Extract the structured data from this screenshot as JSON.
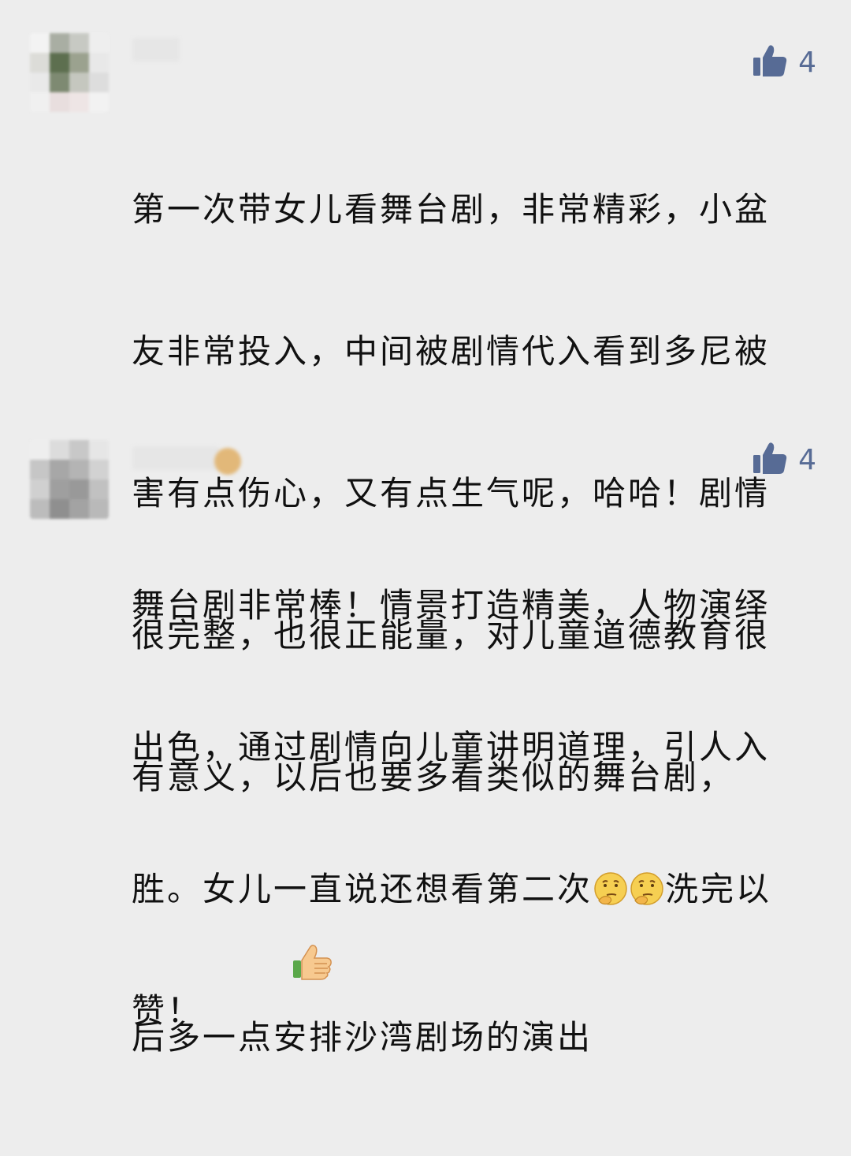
{
  "comments": [
    {
      "like_count": "4",
      "text_lines": [
        "第一次带女儿看舞台剧，非常精彩，小盆",
        "友非常投入，中间被剧情代入看到多尼被",
        "害有点伤心，又有点生气呢，哈哈！剧情",
        "很完整，也很正能量，对儿童道德教育很",
        "有意义，以后也要多看类似的舞台剧，",
        "赞！"
      ],
      "trailing_emoji": "thumbs-up-emoji"
    },
    {
      "like_count": "4",
      "text_lines": [
        "舞台剧非常棒！情景打造精美，人物演绎",
        "出色，通过剧情向儿童讲明道理，引人入",
        "胜。女儿一直说还想看第二次",
        "后多一点安排沙湾剧场的演出"
      ],
      "line3_after_emoji": "洗完以",
      "inline_emoji": "thinking-face-emoji"
    }
  ],
  "colors": {
    "background": "#ededed",
    "like_blue": "#576b95",
    "text": "#111111"
  }
}
